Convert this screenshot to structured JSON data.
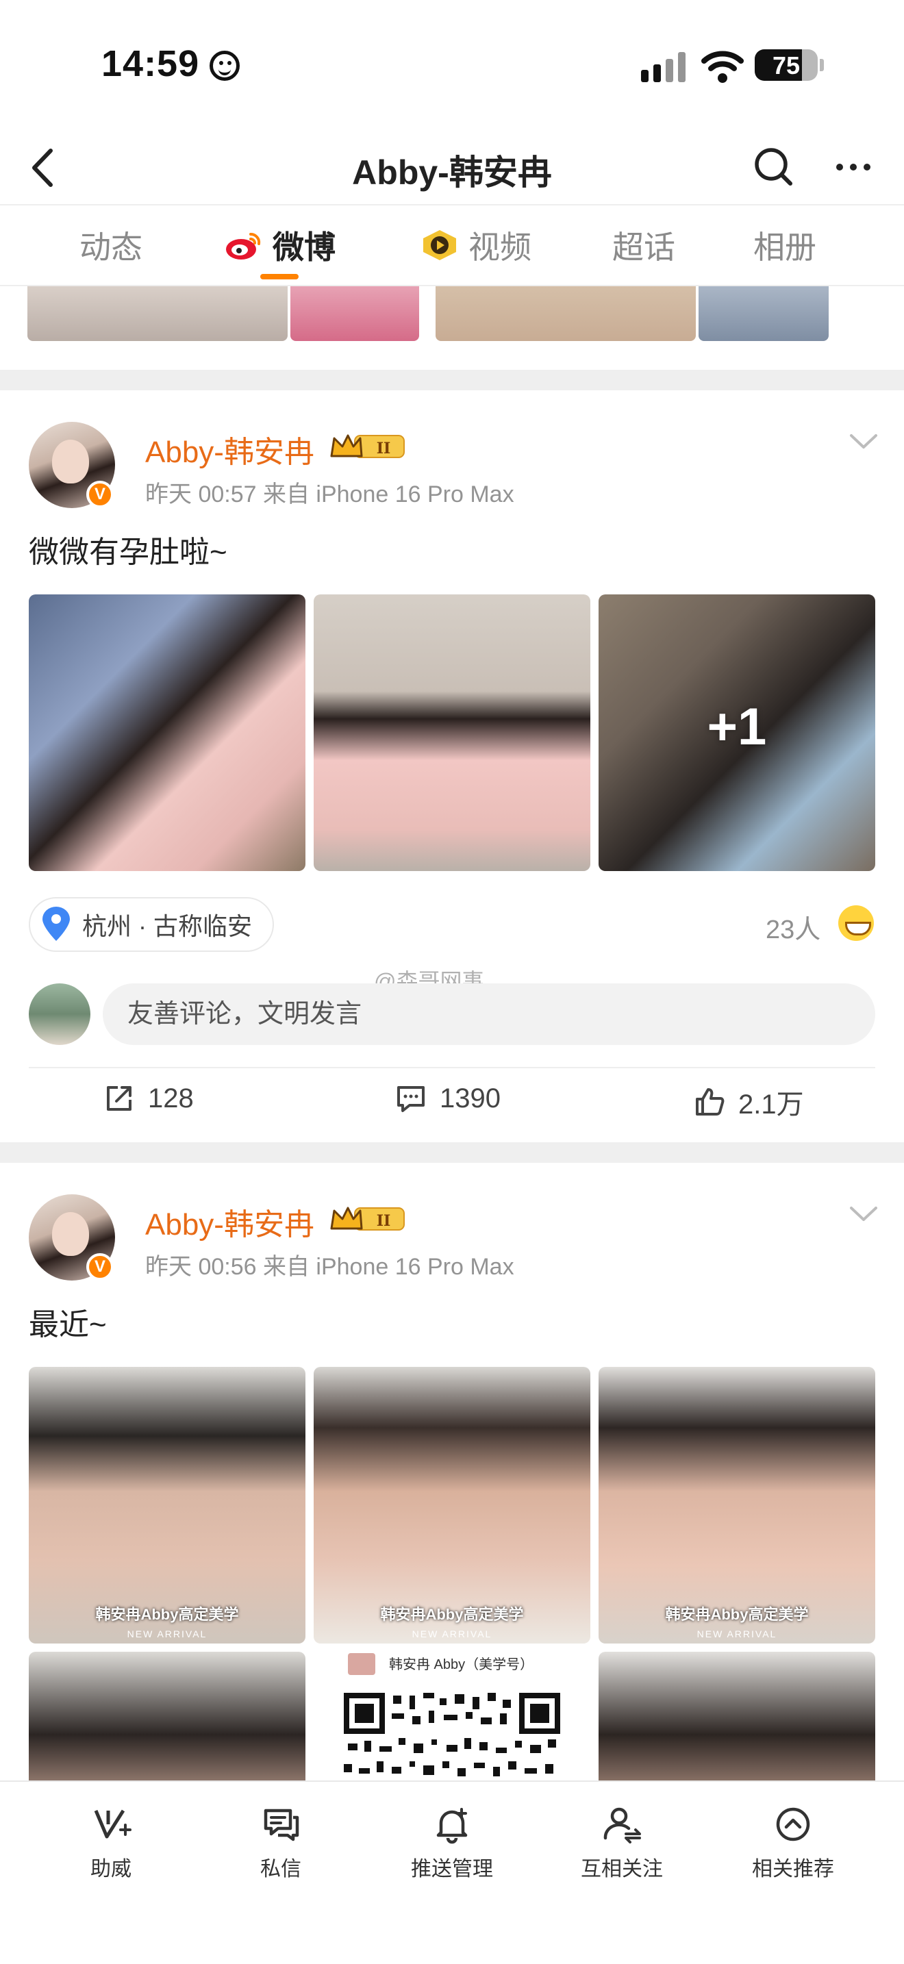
{
  "status_bar": {
    "time": "14:59",
    "battery": "75",
    "battery_fraction": 0.75
  },
  "nav": {
    "title": "Abby-韩安冉"
  },
  "tabs": [
    {
      "label": "动态"
    },
    {
      "label": "微博"
    },
    {
      "label": "视频"
    },
    {
      "label": "超话"
    },
    {
      "label": "相册"
    }
  ],
  "active_tab": "微博",
  "posts": [
    {
      "username": "Abby-韩安冉",
      "vip_level": "II",
      "verified_mark": "V",
      "meta": "昨天 00:57  来自 iPhone 16 Pro Max",
      "text": "微微有孕肚啦~",
      "photo_overlay": "+1",
      "location": "杭州 · 古称临安",
      "reactions": "23人",
      "comment_placeholder": "友善评论，文明发言",
      "watermark": "@森哥网事",
      "shares": "128",
      "comments": "1390",
      "likes": "2.1万"
    },
    {
      "username": "Abby-韩安冉",
      "vip_level": "II",
      "verified_mark": "V",
      "meta": "昨天 00:56  来自 iPhone 16 Pro Max",
      "text": "最近~",
      "photo_captions": [
        "韩安冉Abby高定美学",
        "韩安冉Abby高定美学",
        "韩安冉Abby高定美学"
      ],
      "photo_subcaption": "NEW ARRIVAL",
      "qr_caption": "韩安冉 Abby（美学号）"
    }
  ],
  "toolbar": [
    {
      "label": "助威",
      "icon": "cheer-icon"
    },
    {
      "label": "私信",
      "icon": "message-icon"
    },
    {
      "label": "推送管理",
      "icon": "bell-icon"
    },
    {
      "label": "互相关注",
      "icon": "mutual-follow-icon"
    },
    {
      "label": "相关推荐",
      "icon": "recommend-icon"
    }
  ],
  "colors": {
    "accent": "#ff8200",
    "username": "#e86b17",
    "muted": "#939393",
    "location_pin": "#3f87f5"
  }
}
